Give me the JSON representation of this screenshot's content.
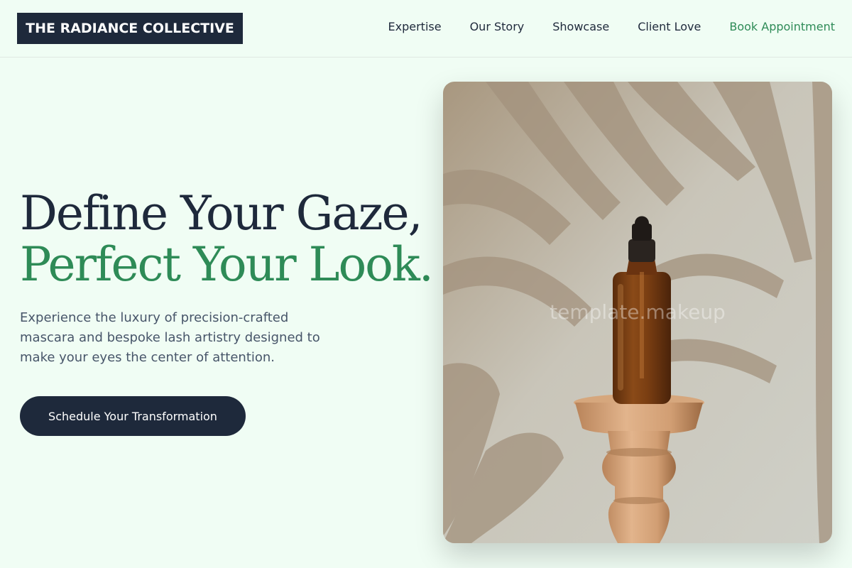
{
  "brand": {
    "name": "THE RADIANCE COLLECTIVE"
  },
  "nav": {
    "items": [
      {
        "label": "Expertise"
      },
      {
        "label": "Our Story"
      },
      {
        "label": "Showcase"
      },
      {
        "label": "Client Love"
      },
      {
        "label": "Book Appointment"
      }
    ]
  },
  "hero": {
    "headline_line1": "Define Your Gaze,",
    "headline_line2": "Perfect Your Look.",
    "description": "Experience the luxury of precision-crafted mascara and bespoke lash artistry designed to make your eyes the center of attention.",
    "cta_label": "Schedule Your Transformation",
    "image_watermark": "template.makeup"
  },
  "colors": {
    "background": "#f0fdf4",
    "primary_dark": "#1e293b",
    "accent_green": "#2e8b57"
  }
}
